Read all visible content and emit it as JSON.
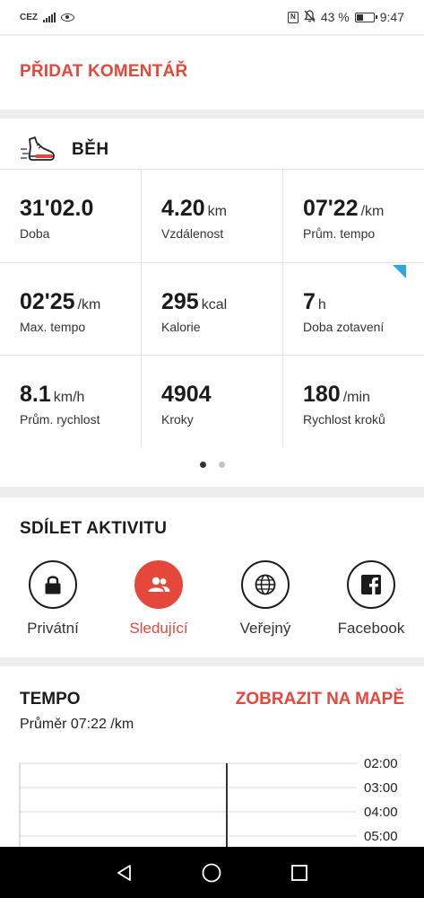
{
  "status_bar": {
    "carrier": "CEZ",
    "nfc": "N",
    "battery": "43 %",
    "battery_level": 0.43,
    "time": "9:47",
    "icons": [
      "signal-icon",
      "eye-icon",
      "nfc-icon",
      "bell-off-icon",
      "battery-icon"
    ]
  },
  "comment": {
    "label": "PŘIDAT KOMENTÁŘ"
  },
  "activity": {
    "icon": "running-shoe-icon",
    "title": "BĚH",
    "stats": [
      {
        "value": "31'02.0",
        "unit": "",
        "label": "Doba"
      },
      {
        "value": "4.20",
        "unit": "km",
        "label": "Vzdálenost"
      },
      {
        "value": "07'22",
        "unit": "/km",
        "label": "Prům. tempo"
      },
      {
        "value": "02'25",
        "unit": "/km",
        "label": "Max. tempo"
      },
      {
        "value": "295",
        "unit": "kcal",
        "label": "Kalorie"
      },
      {
        "value": "7",
        "unit": "h",
        "label": "Doba zotavení"
      },
      {
        "value": "8.1",
        "unit": "km/h",
        "label": "Prům. rychlost"
      },
      {
        "value": "4904",
        "unit": "",
        "label": "Kroky"
      },
      {
        "value": "180",
        "unit": "/min",
        "label": "Rychlost kroků"
      }
    ],
    "pager": {
      "pages": 2,
      "current": 1
    }
  },
  "share": {
    "title": "SDÍLET AKTIVITU",
    "options": [
      {
        "label": "Privátní",
        "icon": "lock-icon",
        "selected": false
      },
      {
        "label": "Sledující",
        "icon": "followers-icon",
        "selected": true
      },
      {
        "label": "Veřejný",
        "icon": "globe-icon",
        "selected": false
      },
      {
        "label": "Facebook",
        "icon": "facebook-icon",
        "selected": false
      }
    ]
  },
  "tempo": {
    "title": "TEMPO",
    "map_link": "ZOBRAZIT NA MAPĚ",
    "average": "Průměr 07:22 /km",
    "y_ticks": [
      "02:00",
      "03:00",
      "04:00",
      "05:00"
    ]
  },
  "colors": {
    "accent": "#e5473a",
    "flag": "#2ea6dc",
    "text": "#1b1b1b"
  },
  "nav": {
    "icons": [
      "back-icon",
      "home-icon",
      "recents-icon"
    ]
  }
}
